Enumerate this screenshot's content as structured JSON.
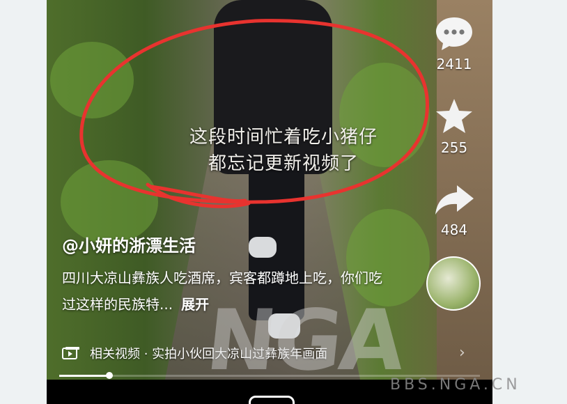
{
  "overlay_caption": {
    "line1": "这段时间忙着吃小猪仔",
    "line2": "都忘记更新视频了"
  },
  "post": {
    "author": "@小妍的浙漂生活",
    "description": "四川大凉山彝族人吃酒席，宾客都蹲地上吃，你们吃过这样的民族特...",
    "expand_label": "展开"
  },
  "related": {
    "icon": "video-icon",
    "text": "相关视频 · 实拍小伙回大凉山过彝族年画面"
  },
  "actions": {
    "comment_count": "2411",
    "favorite_count": "255",
    "share_count": "484"
  },
  "playback": {
    "progress": 0.12
  },
  "watermark": {
    "logo_text": "NGA",
    "url": "BBS.NGA.CN"
  },
  "colors": {
    "annotation_circle": "#e8332f"
  }
}
